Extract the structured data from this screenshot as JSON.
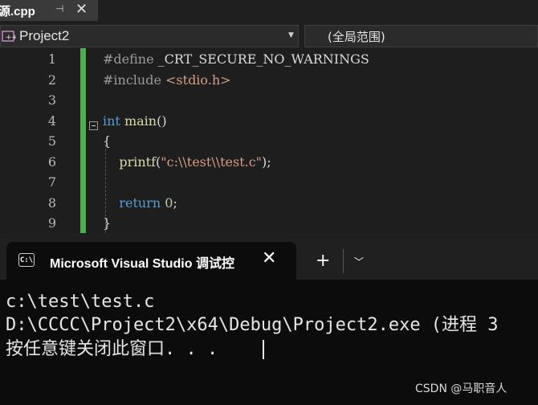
{
  "document_tab": {
    "filename": "源.cpp",
    "pin_icon": "pin-icon",
    "close_icon": "close-icon"
  },
  "navbar": {
    "project": "Project2",
    "scope": "(全局范围)"
  },
  "editor": {
    "line_numbers": [
      "1",
      "2",
      "3",
      "4",
      "5",
      "6",
      "7",
      "8",
      "9"
    ],
    "change_bar_color": "#4caf50"
  },
  "terminal": {
    "tab_title": "Microsoft Visual Studio 调试控",
    "tab_icon": "cmd-icon",
    "new_tab_icon": "plus-icon",
    "dropdown_icon": "chevron-down-icon",
    "output": [
      "c:\\test\\test.c",
      "D:\\CCCC\\Project2\\x64\\Debug\\Project2.exe (进程 3",
      "按任意键关闭此窗口. . ."
    ]
  },
  "watermark": "CSDN @马职音人"
}
